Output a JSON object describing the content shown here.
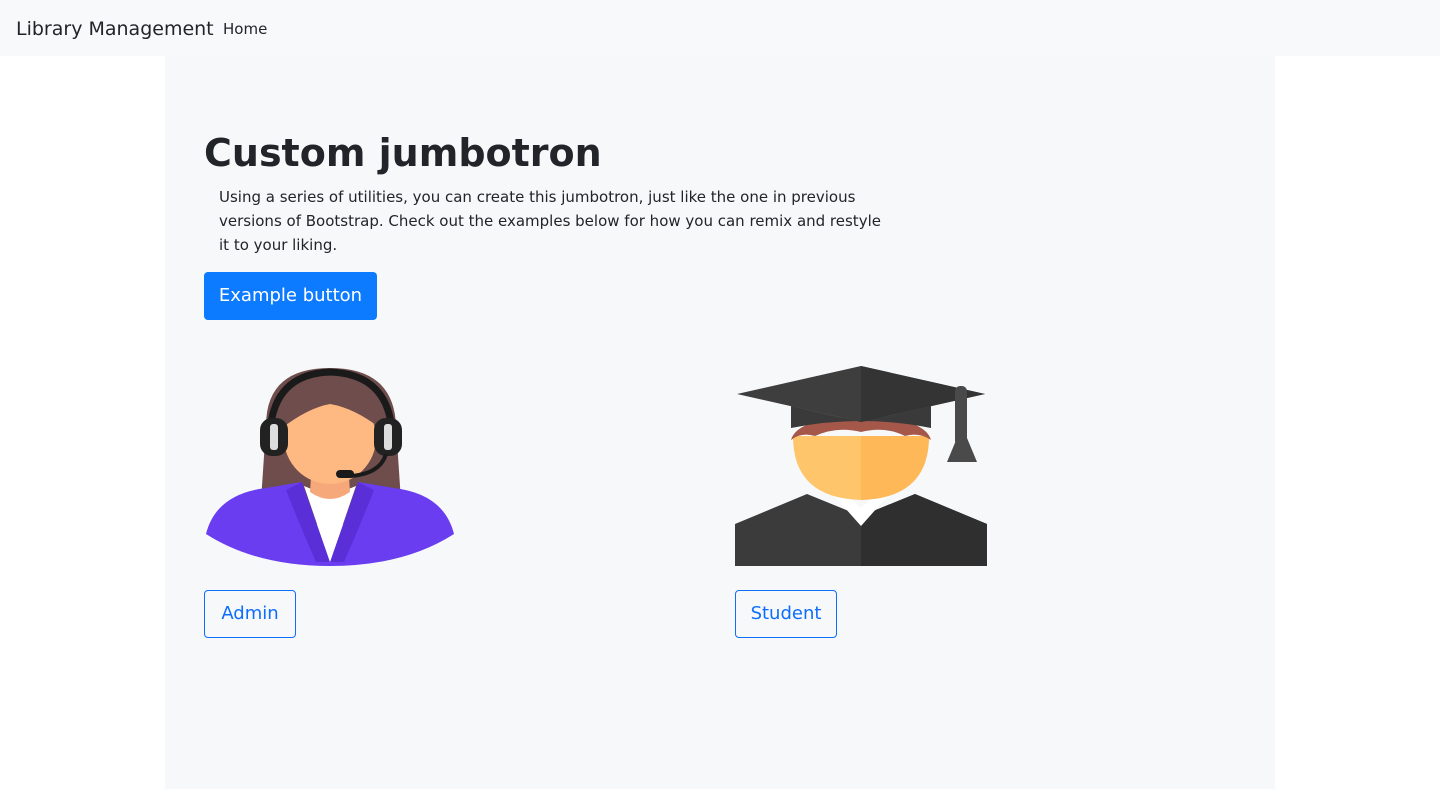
{
  "navbar": {
    "brand": "Library Management",
    "links": [
      {
        "label": "Home"
      }
    ]
  },
  "jumbotron": {
    "title": "Custom jumbotron",
    "lead": "Using a series of utilities, you can create this jumbotron, just like the one in previous versions of Bootstrap. Check out the examples below for how you can remix and restyle it to your liking.",
    "button_label": "Example button"
  },
  "cards": [
    {
      "image_icon": "admin-avatar-icon",
      "button_label": "Admin"
    },
    {
      "image_icon": "student-graduate-icon",
      "button_label": "Student"
    }
  ],
  "colors": {
    "primary": "#0d7bff",
    "outline": "#0d6efd",
    "navbar_bg": "#f8f9fa",
    "jumbotron_bg": "#f7f8fa"
  }
}
